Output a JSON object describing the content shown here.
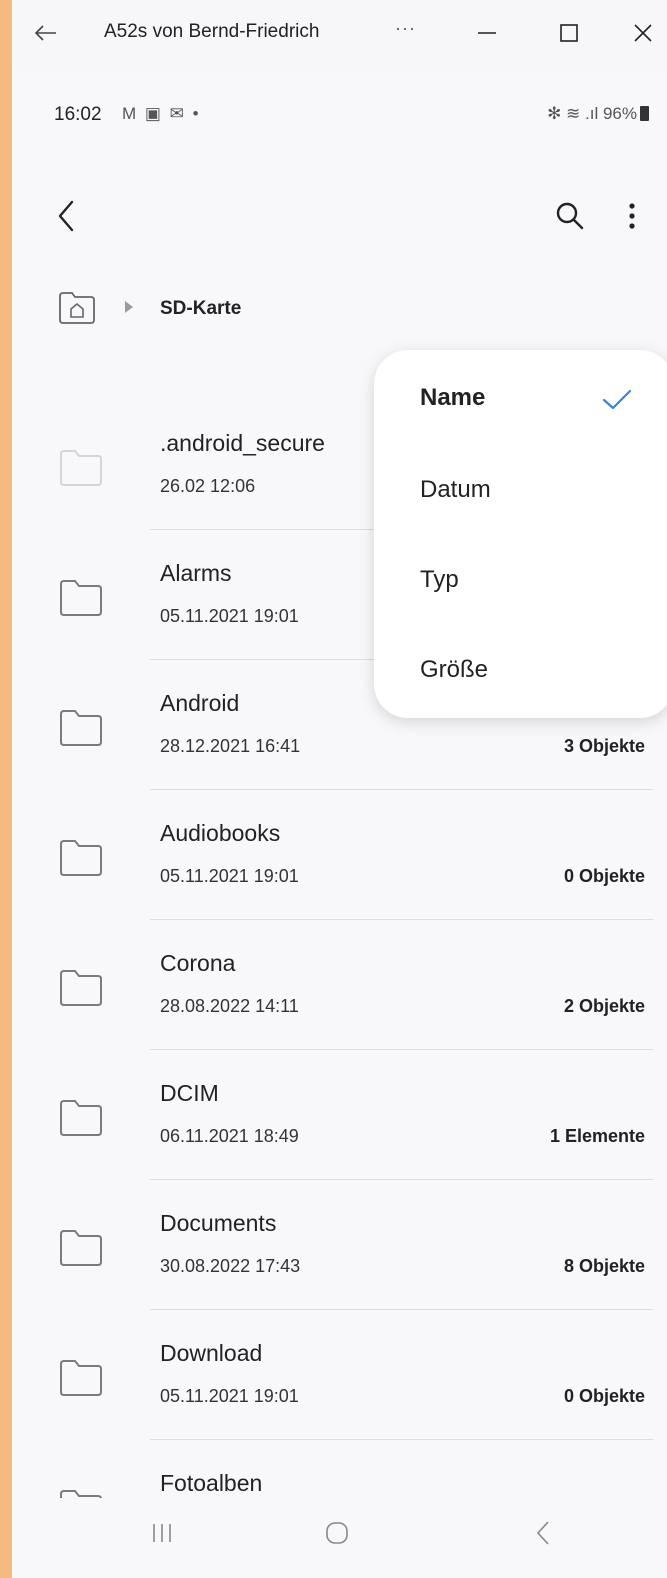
{
  "window": {
    "title": "A52s von Bernd-Friedrich",
    "more_label": "···"
  },
  "status_bar": {
    "time": "16:02",
    "notification_icons": "M ▣ ✉ •",
    "right_text": "✻ ≋ .ıl 96%",
    "battery_percent": 96
  },
  "breadcrumb": {
    "location": "SD-Karte"
  },
  "sort_menu": {
    "options": [
      {
        "label": "Name",
        "selected": true
      },
      {
        "label": "Datum",
        "selected": false
      },
      {
        "label": "Typ",
        "selected": false
      },
      {
        "label": "Größe",
        "selected": false
      }
    ]
  },
  "files": [
    {
      "name": ".android_secure",
      "date": "26.02 12:06",
      "count": "",
      "faded": true
    },
    {
      "name": "Alarms",
      "date": "05.11.2021 19:01",
      "count": ""
    },
    {
      "name": "Android",
      "date": "28.12.2021 16:41",
      "count": "3 Objekte"
    },
    {
      "name": "Audiobooks",
      "date": "05.11.2021 19:01",
      "count": "0 Objekte"
    },
    {
      "name": "Corona",
      "date": "28.08.2022 14:11",
      "count": "2 Objekte"
    },
    {
      "name": "DCIM",
      "date": "06.11.2021 18:49",
      "count": "1 Elemente"
    },
    {
      "name": "Documents",
      "date": "30.08.2022 17:43",
      "count": "8 Objekte"
    },
    {
      "name": "Download",
      "date": "05.11.2021 19:01",
      "count": "0 Objekte"
    },
    {
      "name": "Fotoalben",
      "date": "",
      "count": ""
    }
  ],
  "colors": {
    "background": "#f8f8fb",
    "border_frame": "#f6b97f",
    "accent_check": "#3d7fe0"
  }
}
